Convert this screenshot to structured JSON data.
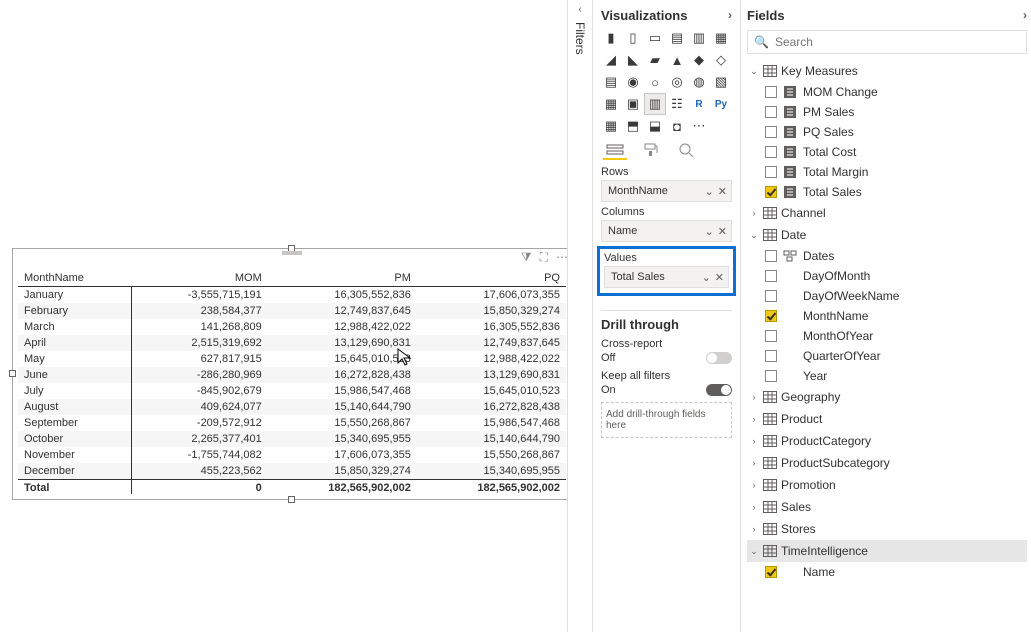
{
  "panes": {
    "filters_label": "Filters",
    "viz_label": "Visualizations",
    "fields_label": "Fields"
  },
  "search": {
    "placeholder": "Search"
  },
  "wells": {
    "rows": {
      "label": "Rows",
      "field": "MonthName"
    },
    "columns": {
      "label": "Columns",
      "field": "Name"
    },
    "values": {
      "label": "Values",
      "field": "Total Sales"
    }
  },
  "drill": {
    "header": "Drill through",
    "cross_label": "Cross-report",
    "cross_state": "Off",
    "keep_label": "Keep all filters",
    "keep_state": "On",
    "placeholder": "Add drill-through fields here"
  },
  "matrix": {
    "columns": [
      "MonthName",
      "MOM",
      "PM",
      "PQ"
    ],
    "rows": [
      {
        "name": "January",
        "mom": "-3,555,715,191",
        "pm": "16,305,552,836",
        "pq": "17,606,073,355"
      },
      {
        "name": "February",
        "mom": "238,584,377",
        "pm": "12,749,837,645",
        "pq": "15,850,329,274"
      },
      {
        "name": "March",
        "mom": "141,268,809",
        "pm": "12,988,422,022",
        "pq": "16,305,552,836"
      },
      {
        "name": "April",
        "mom": "2,515,319,692",
        "pm": "13,129,690,831",
        "pq": "12,749,837,645"
      },
      {
        "name": "May",
        "mom": "627,817,915",
        "pm": "15,645,010,523",
        "pq": "12,988,422,022"
      },
      {
        "name": "June",
        "mom": "-286,280,969",
        "pm": "16,272,828,438",
        "pq": "13,129,690,831"
      },
      {
        "name": "July",
        "mom": "-845,902,679",
        "pm": "15,986,547,468",
        "pq": "15,645,010,523"
      },
      {
        "name": "August",
        "mom": "409,624,077",
        "pm": "15,140,644,790",
        "pq": "16,272,828,438"
      },
      {
        "name": "September",
        "mom": "-209,572,912",
        "pm": "15,550,268,867",
        "pq": "15,986,547,468"
      },
      {
        "name": "October",
        "mom": "2,265,377,401",
        "pm": "15,340,695,955",
        "pq": "15,140,644,790"
      },
      {
        "name": "November",
        "mom": "-1,755,744,082",
        "pm": "17,606,073,355",
        "pq": "15,550,268,867"
      },
      {
        "name": "December",
        "mom": "455,223,562",
        "pm": "15,850,329,274",
        "pq": "15,340,695,955"
      }
    ],
    "totals": {
      "name": "Total",
      "mom": "0",
      "pm": "182,565,902,002",
      "pq": "182,565,902,002"
    }
  },
  "fields_tree": {
    "tables": [
      {
        "name": "Key Measures",
        "expanded": true,
        "icon": "table",
        "fields": [
          {
            "name": "MOM Change",
            "checked": false,
            "type": "measure"
          },
          {
            "name": "PM Sales",
            "checked": false,
            "type": "measure"
          },
          {
            "name": "PQ Sales",
            "checked": false,
            "type": "measure"
          },
          {
            "name": "Total Cost",
            "checked": false,
            "type": "measure"
          },
          {
            "name": "Total Margin",
            "checked": false,
            "type": "measure"
          },
          {
            "name": "Total Sales",
            "checked": true,
            "type": "measure"
          }
        ]
      },
      {
        "name": "Channel",
        "expanded": false,
        "icon": "table",
        "fields": []
      },
      {
        "name": "Date",
        "expanded": true,
        "icon": "table",
        "fields": [
          {
            "name": "Dates",
            "checked": false,
            "type": "hierarchy"
          },
          {
            "name": "DayOfMonth",
            "checked": false,
            "type": "column"
          },
          {
            "name": "DayOfWeekName",
            "checked": false,
            "type": "column"
          },
          {
            "name": "MonthName",
            "checked": true,
            "type": "column"
          },
          {
            "name": "MonthOfYear",
            "checked": false,
            "type": "column"
          },
          {
            "name": "QuarterOfYear",
            "checked": false,
            "type": "column"
          },
          {
            "name": "Year",
            "checked": false,
            "type": "column"
          }
        ]
      },
      {
        "name": "Geography",
        "expanded": false,
        "icon": "table",
        "fields": []
      },
      {
        "name": "Product",
        "expanded": false,
        "icon": "table",
        "fields": []
      },
      {
        "name": "ProductCategory",
        "expanded": false,
        "icon": "table",
        "fields": []
      },
      {
        "name": "ProductSubcategory",
        "expanded": false,
        "icon": "table",
        "fields": []
      },
      {
        "name": "Promotion",
        "expanded": false,
        "icon": "table",
        "fields": []
      },
      {
        "name": "Sales",
        "expanded": false,
        "icon": "table",
        "fields": []
      },
      {
        "name": "Stores",
        "expanded": false,
        "icon": "table",
        "fields": []
      },
      {
        "name": "TimeIntelligence",
        "expanded": true,
        "icon": "table",
        "selected": true,
        "fields": [
          {
            "name": "Name",
            "checked": true,
            "type": "column"
          }
        ]
      }
    ]
  }
}
